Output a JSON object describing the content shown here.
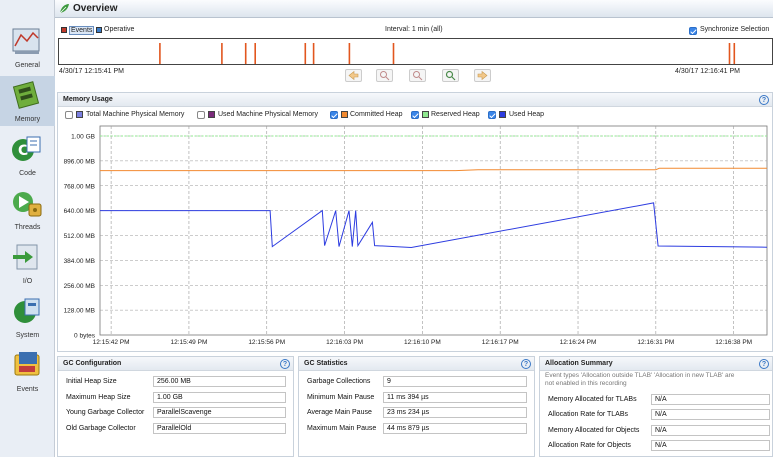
{
  "header": {
    "title": "Overview"
  },
  "sidebar": {
    "items": [
      {
        "label": "General",
        "icon": "chart-icon"
      },
      {
        "label": "Memory",
        "icon": "memory-chip-icon",
        "active": true
      },
      {
        "label": "Code",
        "icon": "java-cup-icon"
      },
      {
        "label": "Threads",
        "icon": "threads-icon"
      },
      {
        "label": "I/O",
        "icon": "io-arrows-icon"
      },
      {
        "label": "System",
        "icon": "system-icon"
      },
      {
        "label": "Events",
        "icon": "events-icon"
      }
    ]
  },
  "overview": {
    "legend_events": "Events",
    "legend_operative": "Operative",
    "interval": "Interval: 1 min (all)",
    "sync_label": "Synchronize Selection",
    "start_time": "4/30/17 12:15:41 PM",
    "end_time": "4/30/17 12:16:41 PM"
  },
  "memory_usage": {
    "title": "Memory Usage",
    "series_toggles": [
      {
        "label": "Total Machine Physical Memory",
        "checked": false,
        "color": "#7b7fe0"
      },
      {
        "label": "Used Machine Physical Memory",
        "checked": false,
        "color": "#7a2a7a"
      },
      {
        "label": "Committed Heap",
        "checked": true,
        "color": "#f28a30"
      },
      {
        "label": "Reserved Heap",
        "checked": true,
        "color": "#8fe88f"
      },
      {
        "label": "Used Heap",
        "checked": true,
        "color": "#2d3ce0"
      }
    ]
  },
  "chart_data": {
    "type": "line",
    "y_ticks": [
      "0 bytes",
      "128.00 MB",
      "256.00 MB",
      "384.00 MB",
      "512.00 MB",
      "640.00 MB",
      "768.00 MB",
      "896.00 MB",
      "1.00 GB"
    ],
    "x_ticks": [
      "12:15:42 PM",
      "12:15:49 PM",
      "12:15:56 PM",
      "12:16:03 PM",
      "12:16:10 PM",
      "12:16:17 PM",
      "12:16:24 PM",
      "12:16:31 PM",
      "12:16:38 PM"
    ],
    "ylim_mb": [
      0,
      1024
    ],
    "xlim_sec": [
      41,
      101
    ],
    "series": [
      {
        "name": "Reserved Heap",
        "color": "#8fe88f",
        "dashed": true,
        "points": [
          [
            41,
            1024
          ],
          [
            101,
            1024
          ]
        ]
      },
      {
        "name": "Committed Heap",
        "color": "#f28a30",
        "points": [
          [
            41,
            846
          ],
          [
            73,
            846
          ],
          [
            75,
            850
          ],
          [
            91,
            850
          ],
          [
            91.3,
            858
          ],
          [
            101,
            858
          ]
        ]
      },
      {
        "name": "Used Heap",
        "color": "#2d3ce0",
        "points": [
          [
            41,
            640
          ],
          [
            56.3,
            640
          ],
          [
            56.5,
            455
          ],
          [
            61,
            640
          ],
          [
            61.2,
            460
          ],
          [
            62.2,
            640
          ],
          [
            62.5,
            455
          ],
          [
            63.4,
            640
          ],
          [
            63.7,
            455
          ],
          [
            64,
            640
          ],
          [
            64.2,
            460
          ],
          [
            65.5,
            580
          ],
          [
            65.7,
            460
          ],
          [
            69,
            450
          ],
          [
            90.8,
            680
          ],
          [
            91.2,
            458
          ],
          [
            101,
            452
          ]
        ]
      }
    ]
  },
  "gc_configuration": {
    "title": "GC Configuration",
    "fields": [
      {
        "label": "Initial Heap Size",
        "value": "256.00 MB"
      },
      {
        "label": "Maximum Heap Size",
        "value": "1.00 GB"
      },
      {
        "label": "Young Garbage Collector",
        "value": "ParallelScavenge"
      },
      {
        "label": "Old Garbage Collector",
        "value": "ParallelOld"
      }
    ]
  },
  "gc_statistics": {
    "title": "GC Statistics",
    "fields": [
      {
        "label": "Garbage Collections",
        "value": "9"
      },
      {
        "label": "Minimum Main Pause",
        "value": "11 ms 394 µs"
      },
      {
        "label": "Average Main Pause",
        "value": "23 ms 234 µs"
      },
      {
        "label": "Maximum Main Pause",
        "value": "44 ms 879 µs"
      }
    ]
  },
  "allocation_summary": {
    "title": "Allocation Summary",
    "note_line1": "Event types 'Allocation outside TLAB' 'Allocation in new TLAB' are",
    "note_line2": "not enabled in this recording",
    "fields": [
      {
        "label": "Memory Allocated for TLABs",
        "value": "N/A"
      },
      {
        "label": "Allocation Rate for TLABs",
        "value": "N/A"
      },
      {
        "label": "Memory Allocated for Objects",
        "value": "N/A"
      },
      {
        "label": "Allocation Rate for Objects",
        "value": "N/A"
      }
    ]
  },
  "timeline_events_sec": [
    49.4,
    54.6,
    56.6,
    57.4,
    61.6,
    62.3,
    65.3,
    69,
    97.2,
    97.6
  ],
  "colors": {
    "event_bar": "#e2561e",
    "accent": "#3b86e8"
  }
}
